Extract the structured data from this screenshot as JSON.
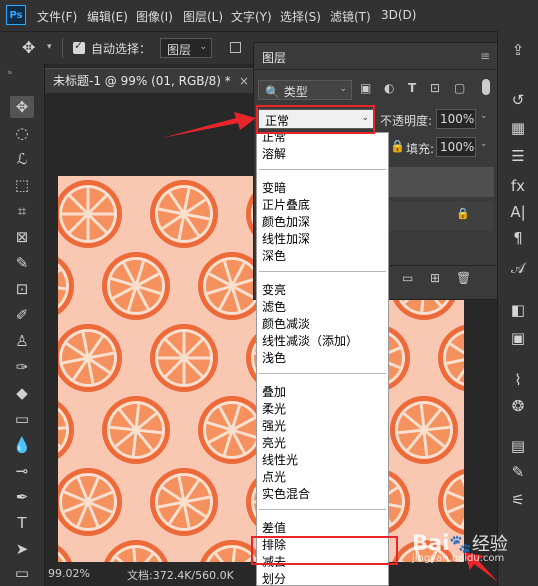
{
  "app": {
    "logo_text": "Ps",
    "menu": [
      "文件(F)",
      "编辑(E)",
      "图像(I)",
      "图层(L)",
      "文字(Y)",
      "选择(S)",
      "滤镜(T)",
      "3D(D)"
    ]
  },
  "options_bar": {
    "auto_select_label": "自动选择：",
    "auto_select_checked": true,
    "auto_select_target": "图层"
  },
  "document": {
    "tab_title": "未标题-1 @ 99% (01, RGB/8) *",
    "zoom": "99.02%",
    "doc_info": "文档:372.4K/560.0K"
  },
  "layers_panel": {
    "title": "图层",
    "filter_kind": "类型",
    "blend_mode": "正常",
    "opacity_label": "不透明度:",
    "opacity_value": "100%",
    "fill_label": "填充:",
    "fill_value": "100%"
  },
  "blend_menu": {
    "groups": [
      [
        "正常",
        "溶解"
      ],
      [
        "变暗",
        "正片叠底",
        "颜色加深",
        "线性加深",
        "深色"
      ],
      [
        "变亮",
        "滤色",
        "颜色减淡",
        "线性减淡（添加）",
        "浅色"
      ],
      [
        "叠加",
        "柔光",
        "强光",
        "亮光",
        "线性光",
        "点光",
        "实色混合"
      ],
      [
        "差值",
        "排除",
        "减去",
        "划分"
      ]
    ],
    "highlighted_item": "排除"
  },
  "annotation_color": "#e8262a",
  "canvas_colors": {
    "background": "#f9c8b2",
    "peel": "#ee6a3a",
    "flesh": "#f4915f",
    "segment_line": "#fbe0cf"
  },
  "watermark": {
    "brand": "Bai",
    "brand_suffix": "经验",
    "url": "jingyan.baidu.com"
  }
}
